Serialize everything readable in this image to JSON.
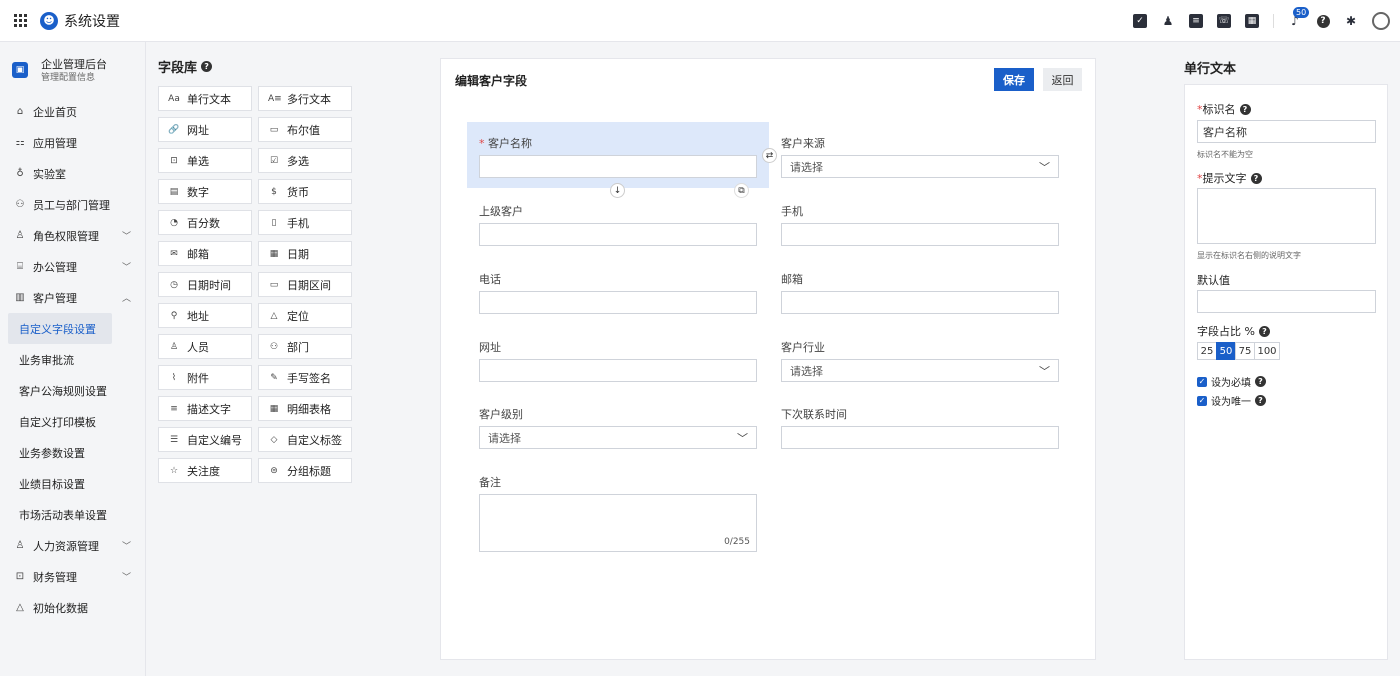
{
  "header": {
    "title": "系统设置",
    "notification_count": "50"
  },
  "sidebar": {
    "org_name": "企业管理后台",
    "org_sub": "管理配置信息",
    "items": [
      {
        "label": "企业首页",
        "icon": "home-icon"
      },
      {
        "label": "应用管理",
        "icon": "apps-icon"
      },
      {
        "label": "实验室",
        "icon": "lab-icon"
      },
      {
        "label": "员工与部门管理",
        "icon": "users-icon"
      },
      {
        "label": "角色权限管理",
        "icon": "role-icon"
      },
      {
        "label": "办公管理",
        "icon": "office-icon"
      },
      {
        "label": "客户管理",
        "icon": "customer-icon"
      }
    ],
    "sub_items": [
      "自定义字段设置",
      "业务审批流",
      "客户公海规则设置",
      "自定义打印模板",
      "业务参数设置",
      "业绩目标设置",
      "市场活动表单设置"
    ],
    "bottom_items": [
      {
        "label": "人力资源管理",
        "icon": "hr-icon"
      },
      {
        "label": "财务管理",
        "icon": "finance-icon"
      },
      {
        "label": "初始化数据",
        "icon": "init-icon"
      }
    ]
  },
  "library": {
    "title": "字段库",
    "fields": [
      {
        "label": "单行文本",
        "icon": "Aa"
      },
      {
        "label": "多行文本",
        "icon": "A≡"
      },
      {
        "label": "网址",
        "icon": "🔗"
      },
      {
        "label": "布尔值",
        "icon": "▭"
      },
      {
        "label": "单选",
        "icon": "⊡"
      },
      {
        "label": "多选",
        "icon": "☑"
      },
      {
        "label": "数字",
        "icon": "▤"
      },
      {
        "label": "货币",
        "icon": "$"
      },
      {
        "label": "百分数",
        "icon": "◔"
      },
      {
        "label": "手机",
        "icon": "▯"
      },
      {
        "label": "邮箱",
        "icon": "✉"
      },
      {
        "label": "日期",
        "icon": "▦"
      },
      {
        "label": "日期时间",
        "icon": "◷"
      },
      {
        "label": "日期区间",
        "icon": "▭"
      },
      {
        "label": "地址",
        "icon": "⚲"
      },
      {
        "label": "定位",
        "icon": "△"
      },
      {
        "label": "人员",
        "icon": "♙"
      },
      {
        "label": "部门",
        "icon": "⚇"
      },
      {
        "label": "附件",
        "icon": "⌇"
      },
      {
        "label": "手写签名",
        "icon": "✎"
      },
      {
        "label": "描述文字",
        "icon": "≡"
      },
      {
        "label": "明细表格",
        "icon": "▦"
      },
      {
        "label": "自定义编号",
        "icon": "☰"
      },
      {
        "label": "自定义标签",
        "icon": "◇"
      },
      {
        "label": "关注度",
        "icon": "☆"
      },
      {
        "label": "分组标题",
        "icon": "⊜"
      }
    ]
  },
  "form": {
    "title": "编辑客户字段",
    "save_label": "保存",
    "back_label": "返回",
    "fields": {
      "customer_name": "客户名称",
      "customer_source": "客户来源",
      "parent_customer": "上级客户",
      "mobile": "手机",
      "phone": "电话",
      "email": "邮箱",
      "website": "网址",
      "industry": "客户行业",
      "level": "客户级别",
      "next_contact": "下次联系时间",
      "remark": "备注"
    },
    "select_placeholder": "请选择",
    "remark_counter": "0/255",
    "required_mark": "*"
  },
  "props": {
    "title": "单行文本",
    "id_label": "标识名",
    "id_value": "客户名称",
    "id_hint": "标识名不能为空",
    "tip_label": "提示文字",
    "tip_hint": "显示在标识名右侧的说明文字",
    "default_label": "默认值",
    "ratio_label": "字段占比 %",
    "ratios": [
      "25",
      "50",
      "75",
      "100"
    ],
    "ratio_selected": "50",
    "required_label": "设为必填",
    "unique_label": "设为唯一"
  },
  "colors": {
    "primary": "#1a5fc9",
    "selected_bg": "#dde8fa",
    "required": "#e04545"
  }
}
